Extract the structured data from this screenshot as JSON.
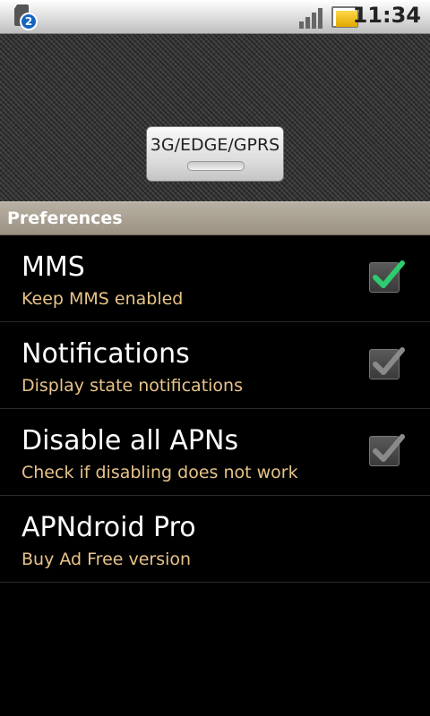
{
  "status_bar": {
    "notification_count": "2",
    "time": "11:34",
    "icons": [
      "sim-notification-icon",
      "signal-icon",
      "battery-icon"
    ]
  },
  "toggle": {
    "label": "3G/EDGE/GPRS",
    "state": "off"
  },
  "preferences": {
    "category": "Preferences",
    "items": [
      {
        "title": "MMS",
        "summary": "Keep MMS enabled",
        "checked": true,
        "enabled": true
      },
      {
        "title": "Notifications",
        "summary": "Display state notifications",
        "checked": true,
        "enabled": false
      },
      {
        "title": "Disable all APNs",
        "summary": "Check if disabling does not work",
        "checked": true,
        "enabled": false
      },
      {
        "title": "APNdroid Pro",
        "summary": "Buy Ad Free version"
      }
    ]
  },
  "colors": {
    "summary_text": "#e8c488",
    "check_active": "#2ecc71",
    "check_disabled": "#8a8a8a",
    "category_bg": "#a8a090"
  }
}
